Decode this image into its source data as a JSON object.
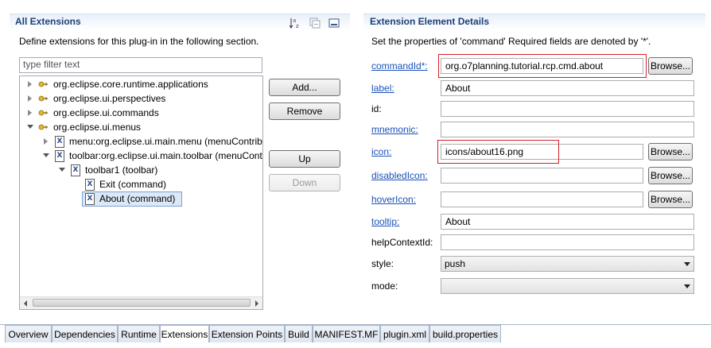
{
  "left_panel": {
    "title": "All Extensions",
    "description": "Define extensions for this plug-in in the following section.",
    "filter_placeholder": "type filter text",
    "toolbar": {
      "sort_icon": "sort-alpha-icon",
      "collapse_icon": "collapse-all-icon",
      "minimize_icon": "minimize-icon"
    },
    "tree": [
      {
        "label": "org.eclipse.core.runtime.applications",
        "icon": "plugin-icon",
        "expanded": false
      },
      {
        "label": "org.eclipse.ui.perspectives",
        "icon": "plugin-icon",
        "expanded": false
      },
      {
        "label": "org.eclipse.ui.commands",
        "icon": "plugin-icon",
        "expanded": false
      },
      {
        "label": "org.eclipse.ui.menus",
        "icon": "plugin-icon",
        "expanded": true
      },
      {
        "label": "menu:org.eclipse.ui.main.menu (menuContribution)",
        "icon": "xml-element-icon",
        "expanded": false
      },
      {
        "label": "toolbar:org.eclipse.ui.main.toolbar (menuContribution)",
        "icon": "xml-element-icon",
        "expanded": true
      },
      {
        "label": "toolbar1 (toolbar)",
        "icon": "xml-element-icon",
        "expanded": true
      },
      {
        "label": "Exit (command)",
        "icon": "xml-element-icon"
      },
      {
        "label": "About (command)",
        "icon": "xml-element-icon",
        "selected": true
      }
    ],
    "buttons": {
      "add": "Add...",
      "remove": "Remove",
      "up": "Up",
      "down": "Down"
    }
  },
  "right_panel": {
    "title": "Extension Element Details",
    "description": "Set the properties of 'command' Required fields are denoted by '*'.",
    "browse_label": "Browse...",
    "fields": {
      "commandId": {
        "label": "commandId*:",
        "value": "org.o7planning.tutorial.rcp.cmd.about"
      },
      "label": {
        "label": "label:",
        "value": "About"
      },
      "id": {
        "label": "id:",
        "value": ""
      },
      "mnemonic": {
        "label": "mnemonic:",
        "value": ""
      },
      "icon": {
        "label": "icon:",
        "value": "icons/about16.png"
      },
      "disabledIcon": {
        "label": "disabledIcon:",
        "value": ""
      },
      "hoverIcon": {
        "label": "hoverIcon:",
        "value": ""
      },
      "tooltip": {
        "label": "tooltip:",
        "value": "About"
      },
      "helpContextId": {
        "label": "helpContextId:",
        "value": ""
      },
      "style": {
        "label": "style:",
        "value": "push"
      },
      "mode": {
        "label": "mode:",
        "value": ""
      }
    }
  },
  "tabs": [
    {
      "label": "Overview"
    },
    {
      "label": "Dependencies"
    },
    {
      "label": "Runtime"
    },
    {
      "label": "Extensions",
      "active": true
    },
    {
      "label": "Extension Points"
    },
    {
      "label": "Build"
    },
    {
      "label": "MANIFEST.MF"
    },
    {
      "label": "plugin.xml"
    },
    {
      "label": "build.properties"
    }
  ],
  "colors": {
    "section_title": "#1d3f78",
    "link": "#1a52b8",
    "highlight_box": "#d4202a",
    "selection": "#dbe8f8"
  }
}
